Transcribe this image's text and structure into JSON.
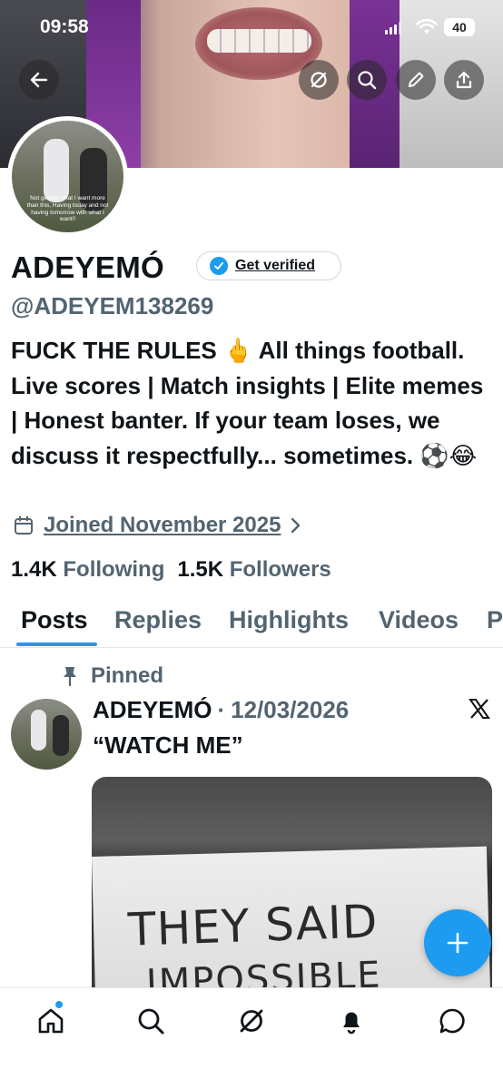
{
  "status_bar": {
    "time": "09:58",
    "battery": "40"
  },
  "profile": {
    "name": "ADEYEMÓ",
    "get_verified_label": "Get verified",
    "handle": "@ADEYEM138269",
    "bio": "FUCK THE RULES 🖕 All things football. Live scores | Match insights | Elite memes | Honest banter. If your team loses, we discuss it respectfully... sometimes. ⚽😂",
    "joined": "Joined November 2025",
    "following_count": "1.4K",
    "following_label": "Following",
    "followers_count": "1.5K",
    "followers_label": "Followers",
    "avatar_caption": "Not getting what I want more than this, Having today and not having tomorrow with what I want!!"
  },
  "tabs": [
    "Posts",
    "Replies",
    "Highlights",
    "Videos",
    "P"
  ],
  "active_tab": "Posts",
  "post": {
    "pinned_label": "Pinned",
    "author": "ADEYEMÓ",
    "separator": "·",
    "date": "12/03/2026",
    "text": "“WATCH ME”",
    "image_text_line1": "THEY SAID",
    "image_text_line2": "IMPOSSIBLE",
    "source_icon": "x-logo-icon"
  },
  "bottom_nav": [
    "home-icon",
    "search-icon",
    "grok-icon",
    "notifications-icon",
    "messages-icon"
  ],
  "colors": {
    "accent": "#1d9bf0",
    "secondary_text": "#536471",
    "primary_text": "#0f1419"
  }
}
